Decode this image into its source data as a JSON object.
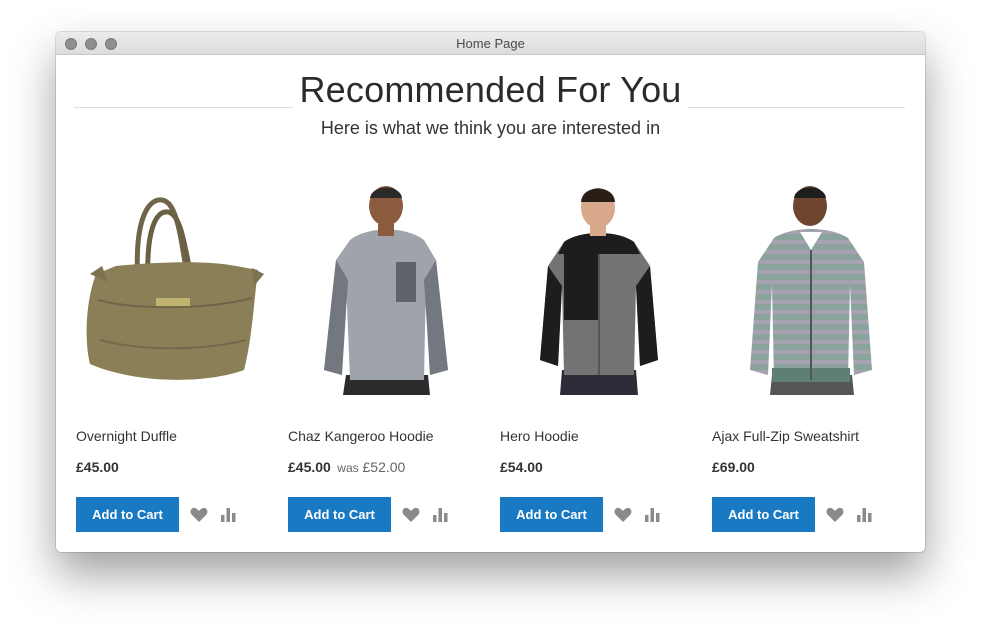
{
  "window": {
    "title": "Home Page"
  },
  "section": {
    "title": "Recommended For You",
    "subtitle": "Here is what we think you are interested in"
  },
  "products": [
    {
      "name": "Overnight Duffle",
      "price": "£45.00",
      "was_label": "",
      "old_price": "",
      "add_to_cart": "Add to Cart",
      "image_icon": "duffle-bag-image"
    },
    {
      "name": "Chaz Kangeroo Hoodie",
      "price": "£45.00",
      "was_label": "was",
      "old_price": "£52.00",
      "add_to_cart": "Add to Cart",
      "image_icon": "gray-hoodie-image"
    },
    {
      "name": "Hero Hoodie",
      "price": "£54.00",
      "was_label": "",
      "old_price": "",
      "add_to_cart": "Add to Cart",
      "image_icon": "black-gray-hoodie-image"
    },
    {
      "name": "Ajax Full-Zip Sweatshirt",
      "price": "£69.00",
      "was_label": "",
      "old_price": "",
      "add_to_cart": "Add to Cart",
      "image_icon": "striped-sweatshirt-image"
    }
  ],
  "icons": {
    "wishlist": "heart-icon",
    "compare": "bar-chart-icon"
  },
  "colors": {
    "primary_button": "#1979c3",
    "icon_gray": "#8a8a8a"
  }
}
